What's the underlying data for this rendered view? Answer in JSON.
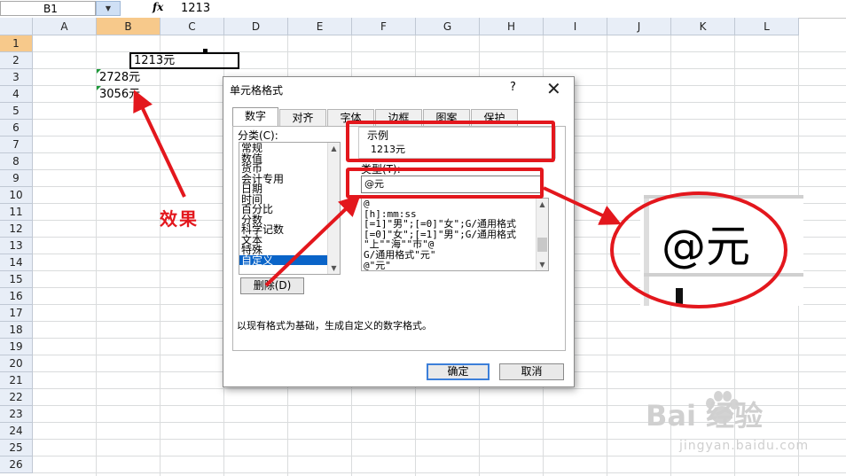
{
  "formula_bar": {
    "name_box": "B1",
    "fx_icon": "fx-icon",
    "formula": "1213"
  },
  "columns": [
    "A",
    "B",
    "C",
    "D",
    "E",
    "F",
    "G",
    "H",
    "I",
    "J",
    "K",
    "L"
  ],
  "rows": [
    "1",
    "2",
    "3",
    "4",
    "5",
    "6",
    "7",
    "8",
    "9",
    "10",
    "11",
    "12",
    "13",
    "14",
    "15",
    "16",
    "17",
    "18",
    "19",
    "20",
    "21",
    "22",
    "23",
    "24",
    "25",
    "26"
  ],
  "cells": {
    "b1": "1213元",
    "b2": "2728元",
    "b3": "3056元"
  },
  "annotation": {
    "effect": "效果"
  },
  "dialog": {
    "title": "单元格格式",
    "help": "?",
    "close": "✕",
    "tabs": [
      "数字",
      "对齐",
      "字体",
      "边框",
      "图案",
      "保护"
    ],
    "category_label": "分类(C):",
    "categories": [
      "常规",
      "数值",
      "货币",
      "会计专用",
      "日期",
      "时间",
      "百分比",
      "分数",
      "科学记数",
      "文本",
      "特殊",
      "自定义"
    ],
    "selected_category": "自定义",
    "sample_label": "示例",
    "sample_value": "1213元",
    "type_label": "类型(T):",
    "type_value": "@元",
    "format_list": [
      "@",
      "[h]:mm:ss",
      "[=1]\"男\";[=0]\"女\";G/通用格式",
      "[=0]\"女\";[=1]\"男\";G/通用格式",
      "\"上\"\"海\"\"市\"@",
      "G/通用格式\"元\"",
      "@\"元\""
    ],
    "delete_button": "删除(D)",
    "description": "以现有格式为基础，生成自定义的数字格式。",
    "ok_button": "确定",
    "cancel_button": "取消"
  },
  "zoom": {
    "text": "@元"
  },
  "watermark": {
    "brand": "Bai  经验",
    "url": "jingyan.baidu.com"
  },
  "colors": {
    "accent_red": "#e3171d",
    "selected_blue": "#0a64c8",
    "header_orange": "#f7c98b"
  }
}
